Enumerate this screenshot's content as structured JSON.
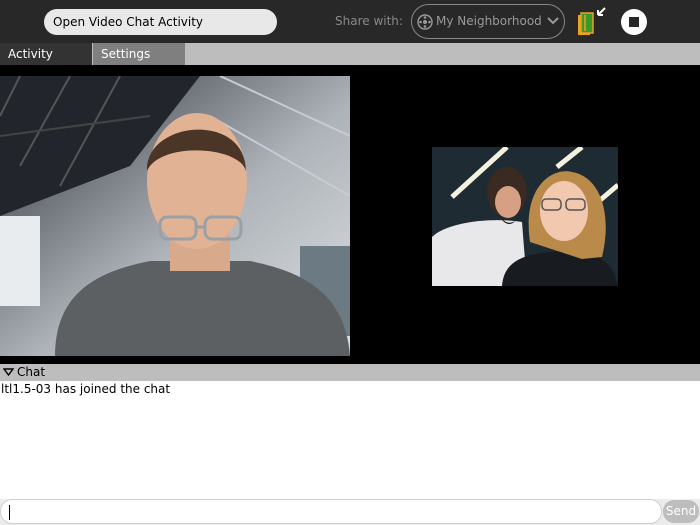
{
  "toolbar": {
    "activity_title": "Open Video Chat Activity",
    "share_label": "Share with:",
    "share_value": "My Neighborhood",
    "keep_icon": "keep-journal-icon",
    "stop_icon": "stop-icon"
  },
  "tabs": [
    {
      "label": "Activity",
      "active": true
    },
    {
      "label": "Settings",
      "active": false
    }
  ],
  "chat": {
    "header": "Chat",
    "messages": [
      "ltl1.5-03 has joined the chat"
    ],
    "entry_value": "",
    "send_label": "Send"
  },
  "colors": {
    "toolbar_bg": "#282828",
    "tabbar_bg": "#bdbdbd",
    "active_tab_bg": "#333333",
    "keep_green": "#3c9a2a",
    "keep_orange": "#f0a020"
  }
}
